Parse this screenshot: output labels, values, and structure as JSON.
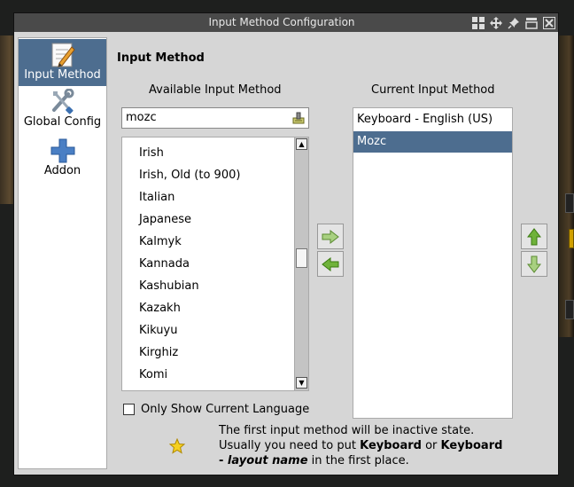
{
  "window": {
    "title": "Input Method Configuration",
    "controls": [
      "tile-icon",
      "move-icon",
      "pin-icon",
      "shade-icon",
      "close-icon"
    ]
  },
  "sidebar": {
    "items": [
      {
        "label": "Input Method",
        "icon": "pencil-note-icon",
        "selected": true
      },
      {
        "label": "Global Config",
        "icon": "tools-icon",
        "selected": false
      },
      {
        "label": "Addon",
        "icon": "plus-icon",
        "selected": false
      }
    ]
  },
  "main": {
    "section_title": "Input Method",
    "available_title": "Available Input Method",
    "current_title": "Current Input Method",
    "search": {
      "value": "mozc",
      "clear_icon": "clear-icon"
    },
    "available": [
      "Irish",
      "Irish, Old (to 900)",
      "Italian",
      "Japanese",
      "Kalmyk",
      "Kannada",
      "Kashubian",
      "Kazakh",
      "Kikuyu",
      "Kirghiz",
      "Komi"
    ],
    "current": [
      {
        "label": "Keyboard - English (US)",
        "selected": false
      },
      {
        "label": "Mozc",
        "selected": true
      }
    ],
    "only_current_language": {
      "label": "Only Show Current Language",
      "checked": false
    },
    "hint": {
      "line1": "The first input method will be inactive state.",
      "line2_a": "Usually you need to put ",
      "bold1": "Keyboard",
      "or": " or ",
      "bold2": "Keyboard",
      "dash": "- ",
      "italic": "layout name",
      "tail": " in the first place."
    }
  },
  "colors": {
    "selection": "#4d6d8f",
    "arrow_green": "#6fb23a",
    "titlebar": "#4a4a4a"
  }
}
